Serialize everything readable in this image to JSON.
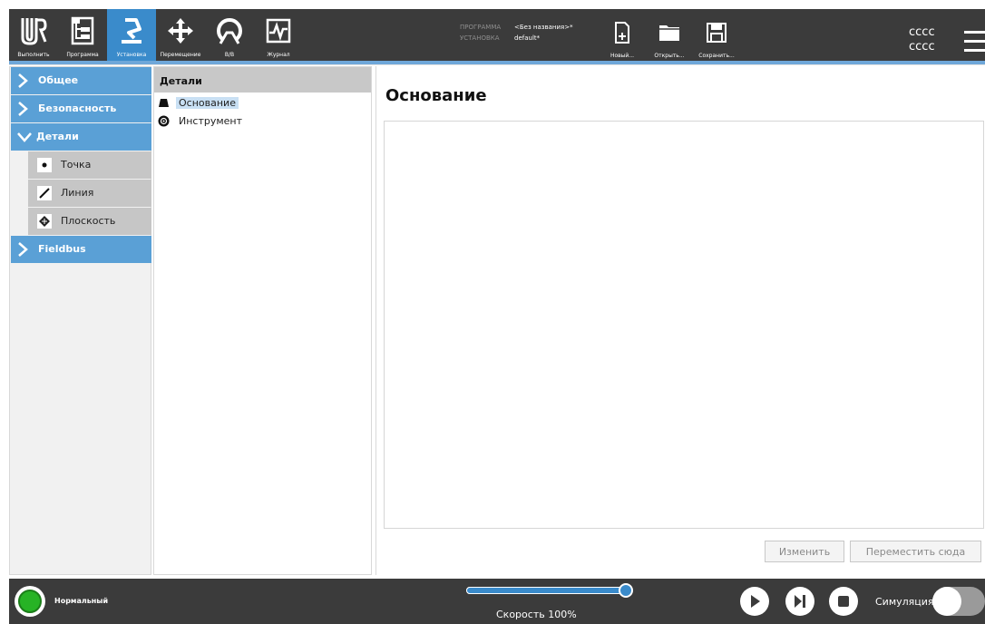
{
  "topbar": {
    "nav": [
      {
        "label": "Выполнить",
        "icon": "ur-logo-icon"
      },
      {
        "label": "Программа",
        "icon": "program-icon"
      },
      {
        "label": "Установка",
        "icon": "installation-icon",
        "active": true
      },
      {
        "label": "Перемещение",
        "icon": "move-icon"
      },
      {
        "label": "В/В",
        "icon": "io-icon"
      },
      {
        "label": "Журнал",
        "icon": "log-icon"
      }
    ],
    "program_key": "ПРОГРАММА",
    "program_value": "<Без названия>*",
    "installation_key": "УСТАНОВКА",
    "installation_value": "default*",
    "file_buttons": [
      {
        "label": "Новый...",
        "icon": "new-file-icon"
      },
      {
        "label": "Открыть...",
        "icon": "open-folder-icon"
      },
      {
        "label": "Сохранить...",
        "icon": "save-icon"
      }
    ],
    "robot_name_line1": "cccc",
    "robot_name_line2": "cccc",
    "menu_icon": "hamburger-menu-icon"
  },
  "left_tree": {
    "general": "Общее",
    "safety": "Безопасность",
    "features": "Детали",
    "feature_items": [
      {
        "label": "Точка",
        "icon": "point-icon"
      },
      {
        "label": "Линия",
        "icon": "line-icon"
      },
      {
        "label": "Плоскость",
        "icon": "plane-icon"
      }
    ],
    "fieldbus": "Fieldbus"
  },
  "middle_tree": {
    "header": "Детали",
    "items": [
      {
        "label": "Основание",
        "icon": "base-icon",
        "selected": true
      },
      {
        "label": "Инструмент",
        "icon": "tool-icon",
        "selected": false
      }
    ]
  },
  "main": {
    "title": "Основание",
    "edit_button": "Изменить",
    "move_here_button": "Переместить сюда"
  },
  "footer": {
    "status_text": "Нормальный",
    "status_color": "#27b325",
    "speed_fraction": 1.0,
    "speed_label": "Скорость 100%",
    "simulation_label": "Симуляция",
    "simulation_on": false
  },
  "colors": {
    "accent": "#3a8bcb",
    "tree_blue": "#5aa0d6",
    "dark_bar": "#3b3b3b"
  }
}
